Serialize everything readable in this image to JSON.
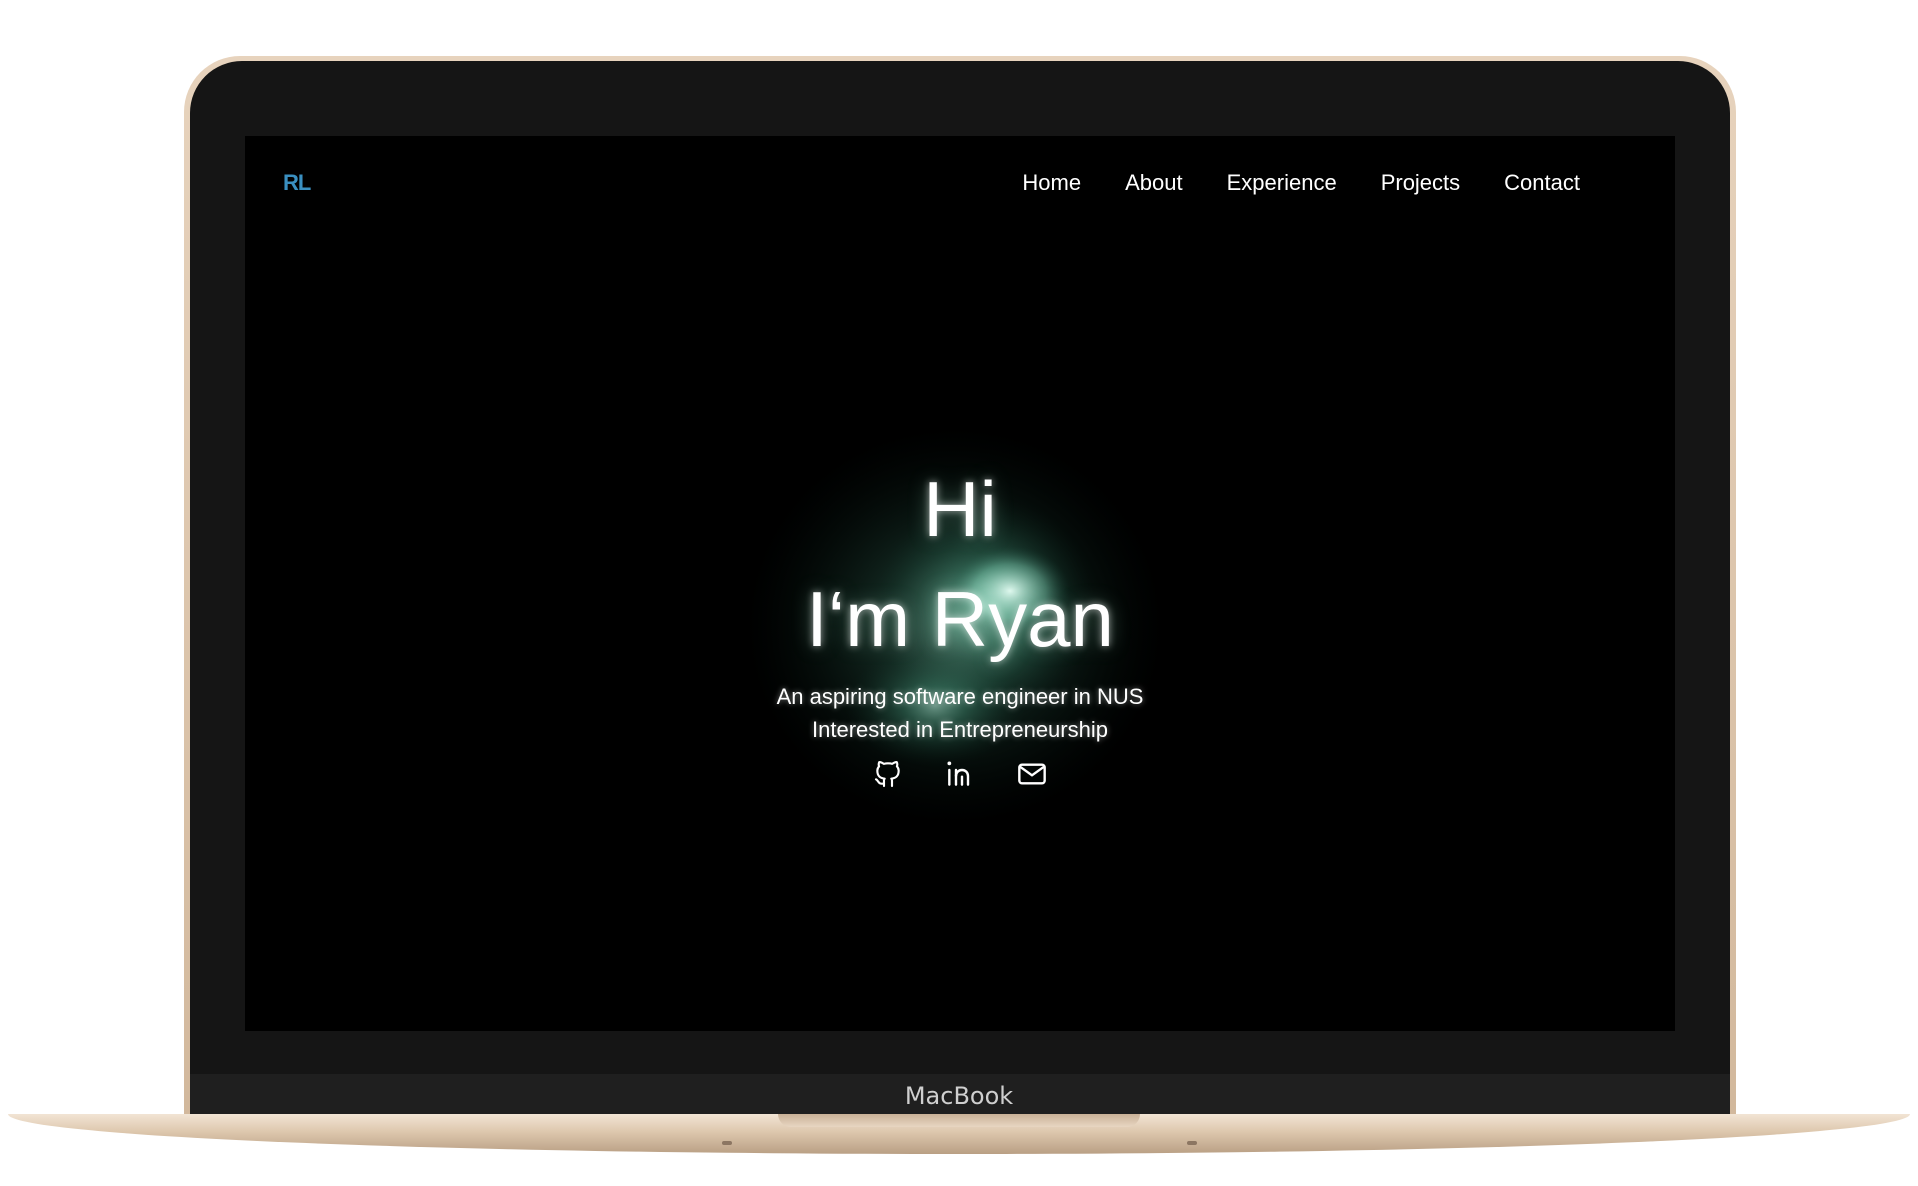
{
  "device": {
    "brand": "MacBook"
  },
  "site": {
    "logo": "RL",
    "nav": [
      "Home",
      "About",
      "Experience",
      "Projects",
      "Contact"
    ]
  },
  "hero": {
    "greeting": "Hi",
    "name_line": "I‘m Ryan",
    "tagline_1": "An aspiring software engineer in NUS",
    "tagline_2": "Interested in Entrepreneurship",
    "socials": [
      "github-icon",
      "linkedin-icon",
      "mail-icon"
    ]
  },
  "colors": {
    "screen_bg": "#000000",
    "text": "#ffffff",
    "logo": "#3a8fc0",
    "particle_glow": "#7fe0c0"
  }
}
